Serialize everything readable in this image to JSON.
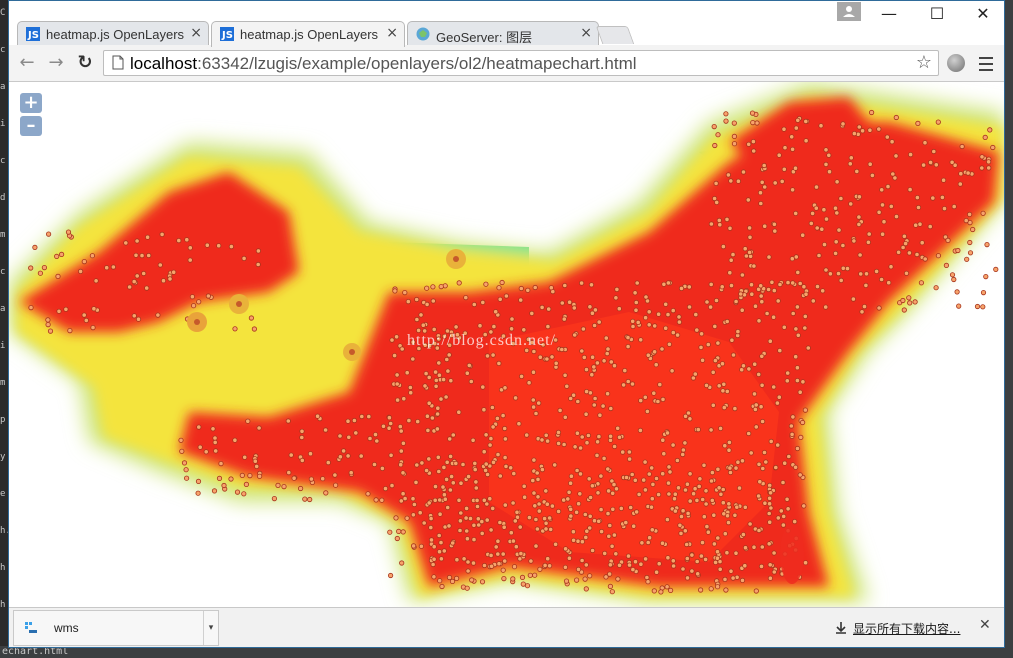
{
  "tabs": [
    {
      "label": "heatmap.js OpenLayers",
      "close": "×",
      "icon": "webstorm-icon"
    },
    {
      "label": "heatmap.js OpenLayers",
      "close": "×",
      "icon": "webstorm-icon"
    },
    {
      "label": "GeoServer: 图层",
      "close": "×",
      "icon": "geoserver-icon"
    }
  ],
  "window_controls": {
    "minimize": "—",
    "maximize": "☐",
    "close": "✕"
  },
  "toolbar": {
    "back": "←",
    "forward": "→",
    "reload": "↻",
    "star": "☆"
  },
  "address": {
    "host": "localhost",
    "path": ":63342/lzugis/example/openlayers/ol2/heatmapechart.html"
  },
  "map": {
    "zoom_in": "+",
    "zoom_out": "–",
    "watermark": "http://blog.csdn.net/"
  },
  "downloads": {
    "item_name": "wms",
    "item_arrow": "▾",
    "show_all": "显示所有下载内容...",
    "close": "✕"
  },
  "ide": {
    "side_chars": [
      "C",
      "c",
      "a",
      "i",
      "c",
      "d",
      "m",
      "c",
      "a",
      "i",
      "m",
      "p",
      "y",
      "e",
      "h.",
      "h",
      "h"
    ],
    "bottom_text": "echart.html"
  },
  "colors": {
    "heat_core": "#f0281e",
    "heat_mid": "#f5e23a",
    "heat_edge": "#a8e37a",
    "basemap_tan": "#d9b99a",
    "basemap_green": "#5fe39a"
  }
}
